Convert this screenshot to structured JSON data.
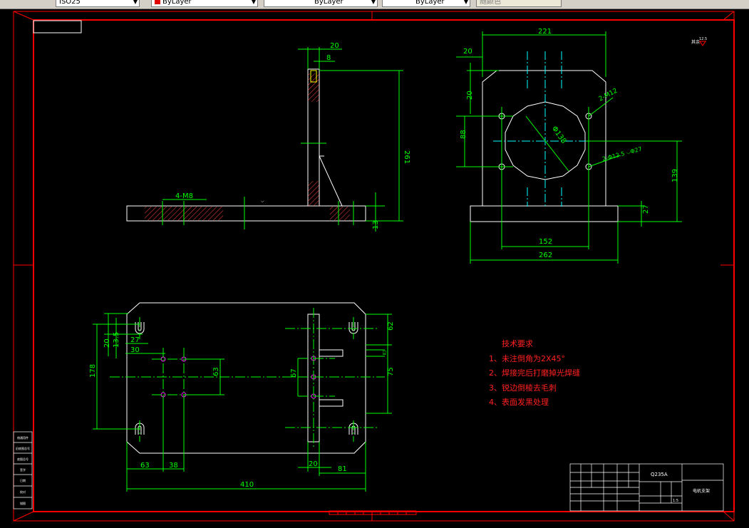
{
  "toolbar": {
    "style_combo": "ISO25",
    "color_combo": "ByLayer",
    "linetype_combo": "ByLayer",
    "lineweight_combo": "ByLayer",
    "plotstyle_combo": "随颜色"
  },
  "colors": {
    "frame": "#ff0000",
    "dimension": "#00ff00",
    "outline": "#ffffff",
    "centerline": "#00ffff",
    "hatch": "#ff4040",
    "hole": "#ff00ff",
    "notes": "#ff2020"
  },
  "drawing": {
    "side_view_dims": {
      "top_width": "20",
      "inner": "8",
      "height": "261",
      "base": "13",
      "thread": "4-M8"
    },
    "front_view_dims": {
      "width": "221",
      "left": "20",
      "top": "20",
      "bore": "Φ138",
      "holes": "2-M12",
      "holes2": "2-Φ12.5 ⌵Φ27",
      "mid_height": "88",
      "center_height": "139",
      "base_height": "27",
      "hole_spacing": "152",
      "base_width": "262"
    },
    "plan_view_dims": {
      "d_20": "20",
      "d_13_5": "13.5",
      "d_27": "27",
      "d_30": "30",
      "d_178": "178",
      "d_63a": "63",
      "d_67": "67",
      "d_62": "62",
      "d_75": "75",
      "d_63b": "63",
      "d_38": "38",
      "d_20b": "20",
      "d_81": "81",
      "d_410": "410"
    },
    "notes_title": "技术要求",
    "notes": [
      "1、未注倒角为2X45°",
      "2、焊接完后打磨掉光焊缝",
      "3、锐边倒棱去毛刺",
      "4、表面发黑处理"
    ],
    "roughness_note": "其余",
    "roughness_value": "12.5",
    "title_block": {
      "material": "Q235A",
      "part_name": "电机支架",
      "scale": "1:5"
    },
    "left_strip": [
      "借通用件",
      "旧底图总号",
      "底图总号",
      "签字",
      "日期",
      "校对",
      "描图"
    ]
  }
}
